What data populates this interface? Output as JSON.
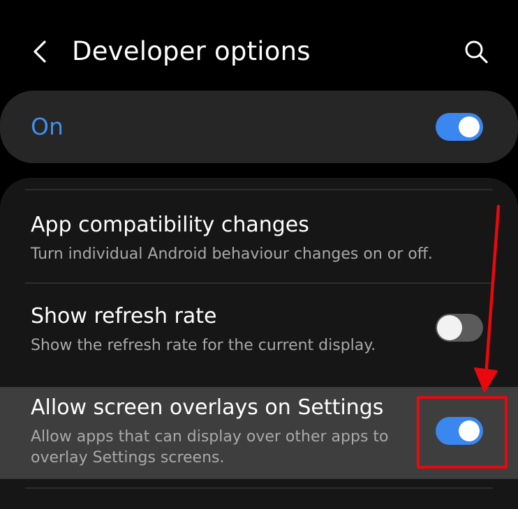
{
  "header": {
    "title": "Developer options",
    "back_icon": "chevron-left-icon",
    "search_icon": "search-icon"
  },
  "master_switch": {
    "label": "On",
    "state": "on",
    "accent_color": "#3a87f0"
  },
  "items": [
    {
      "title": "App compatibility changes",
      "subtitle": "Turn individual Android behaviour changes on or off."
    },
    {
      "title": "Show refresh rate",
      "subtitle": "Show the refresh rate for the current display.",
      "toggle": "off"
    },
    {
      "title": "Allow screen overlays on Settings",
      "subtitle": "Allow apps that can display over other apps to overlay Settings screens.",
      "toggle": "on",
      "highlighted": true
    }
  ],
  "annotation": {
    "color": "#e8080d",
    "type": "arrow-and-box"
  }
}
